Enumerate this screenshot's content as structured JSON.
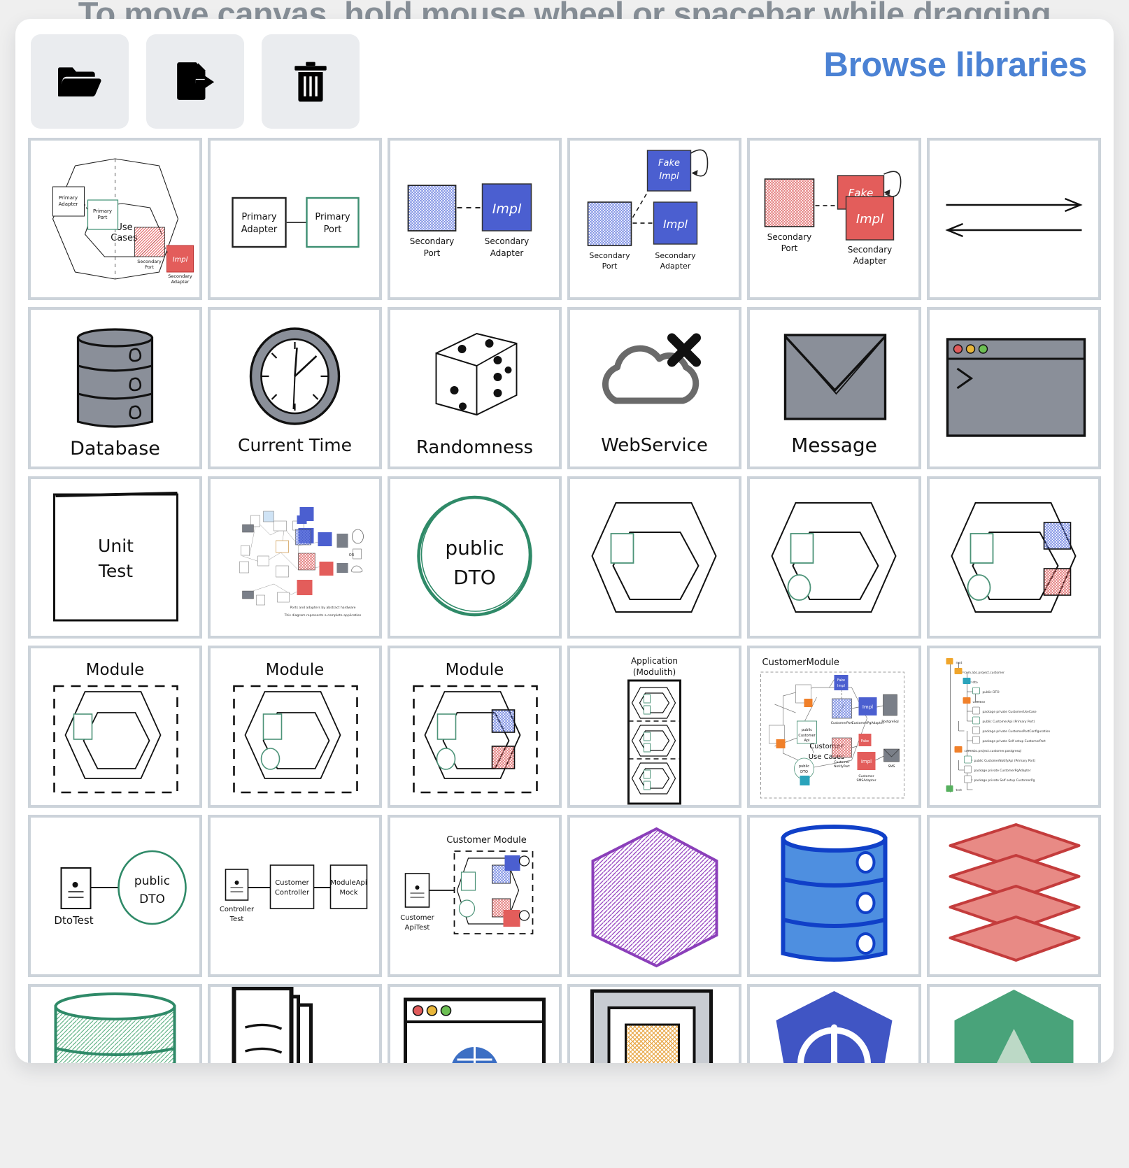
{
  "canvas": {
    "hint_text": "To move canvas, hold mouse wheel or spacebar while dragging"
  },
  "panel": {
    "background": "#ffffff",
    "tile_border_color": "#ccd3da"
  },
  "toolbar": {
    "buttons": [
      {
        "name": "open-folder-button",
        "icon": "folder-open-icon",
        "label": ""
      },
      {
        "name": "export-file-button",
        "icon": "file-export-icon",
        "label": ""
      },
      {
        "name": "delete-button",
        "icon": "trash-icon",
        "label": ""
      }
    ],
    "browse_link": {
      "label": "Browse libraries",
      "color": "#4b82d4"
    }
  },
  "library": {
    "columns": 6,
    "tiles": [
      {
        "id": "hexagonal-architecture-overview",
        "kind": "diagram",
        "labels": [
          "Primary Adapter",
          "Primary Port",
          "Use Cases",
          "Secondary Port",
          "Impl",
          "Secondary Adapter"
        ]
      },
      {
        "id": "primary-adapter-to-primary-port",
        "kind": "diagram",
        "labels": [
          "Primary Adapter",
          "Primary Port"
        ]
      },
      {
        "id": "secondary-port-blue-impl",
        "kind": "diagram",
        "labels": [
          "Secondary Port",
          "Impl",
          "Secondary Adapter"
        ]
      },
      {
        "id": "secondary-port-blue-fake-impl",
        "kind": "diagram",
        "labels": [
          "Fake Impl",
          "Impl",
          "Secondary Port",
          "Secondary Adapter"
        ]
      },
      {
        "id": "secondary-port-red-fake-impl",
        "kind": "diagram",
        "labels": [
          "Fake",
          "Impl",
          "Secondary Port",
          "Secondary Adapter"
        ]
      },
      {
        "id": "arrows",
        "kind": "shape",
        "labels": []
      },
      {
        "id": "database",
        "kind": "icon",
        "labels": [
          "Database"
        ]
      },
      {
        "id": "current-time",
        "kind": "icon",
        "labels": [
          "Current Time"
        ]
      },
      {
        "id": "randomness",
        "kind": "icon",
        "labels": [
          "Randomness"
        ]
      },
      {
        "id": "web-service",
        "kind": "icon",
        "labels": [
          "WebService"
        ]
      },
      {
        "id": "message",
        "kind": "icon",
        "labels": [
          "Message"
        ]
      },
      {
        "id": "terminal-window",
        "kind": "icon",
        "labels": []
      },
      {
        "id": "unit-test",
        "kind": "shape",
        "labels": [
          "Unit Test"
        ]
      },
      {
        "id": "full-architecture-poster",
        "kind": "diagram",
        "labels": [
          "Ports and adapters by abstract hardware",
          "This diagram represents a complete application"
        ]
      },
      {
        "id": "public-dto",
        "kind": "shape",
        "labels": [
          "public DTO"
        ]
      },
      {
        "id": "hexagon-empty",
        "kind": "shape",
        "labels": []
      },
      {
        "id": "hexagon-with-ports",
        "kind": "shape",
        "labels": []
      },
      {
        "id": "hexagon-with-adapters",
        "kind": "shape",
        "labels": []
      },
      {
        "id": "module-empty",
        "kind": "shape",
        "labels": [
          "Module"
        ]
      },
      {
        "id": "module-with-ports",
        "kind": "shape",
        "labels": [
          "Module"
        ]
      },
      {
        "id": "module-with-adapters",
        "kind": "shape",
        "labels": [
          "Module"
        ]
      },
      {
        "id": "application-modulith",
        "kind": "diagram",
        "labels": [
          "Application",
          "(Modulith)"
        ]
      },
      {
        "id": "customer-module",
        "kind": "diagram",
        "labels": [
          "CustomerModule",
          "Customer Use Cases",
          "Impl",
          "Fake Impl",
          "public DTO"
        ]
      },
      {
        "id": "package-tree",
        "kind": "diagram",
        "labels": []
      },
      {
        "id": "dto-test",
        "kind": "diagram",
        "labels": [
          "DtoTest",
          "public DTO"
        ]
      },
      {
        "id": "controller-test",
        "kind": "diagram",
        "labels": [
          "Controller Test",
          "Customer Controller",
          "ModuleApi Mock"
        ]
      },
      {
        "id": "customer-api-test",
        "kind": "diagram",
        "labels": [
          "Customer ApiTest",
          "Customer Module"
        ]
      },
      {
        "id": "purple-hexagon",
        "kind": "shape",
        "labels": []
      },
      {
        "id": "blue-database",
        "kind": "icon",
        "labels": []
      },
      {
        "id": "red-layers",
        "kind": "icon",
        "labels": []
      },
      {
        "id": "green-database",
        "kind": "icon",
        "labels": []
      },
      {
        "id": "documents",
        "kind": "icon",
        "labels": []
      },
      {
        "id": "browser-window",
        "kind": "icon",
        "labels": []
      },
      {
        "id": "orange-frame",
        "kind": "icon",
        "labels": []
      },
      {
        "id": "kubernetes-logo",
        "kind": "icon",
        "labels": []
      },
      {
        "id": "green-logo",
        "kind": "icon",
        "labels": []
      }
    ]
  }
}
